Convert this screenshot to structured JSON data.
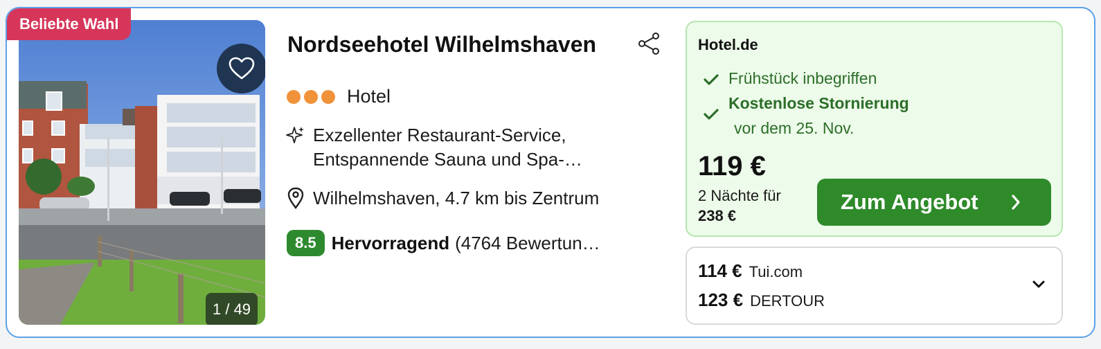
{
  "badge": "Beliebte Wahl",
  "photo": {
    "counter": "1 / 49"
  },
  "hotel": {
    "name": "Nordseehotel Wilhelmshaven",
    "type": "Hotel",
    "stars": 3,
    "features": "Exzellenter Restaurant-Service, Entspannende Sauna und Spa-…",
    "location": "Wilhelmshaven, 4.7 km bis Zentrum",
    "rating": {
      "score": "8.5",
      "label": "Hervorragend",
      "count": "(4764 Bewertun…"
    }
  },
  "offer": {
    "provider": "Hotel.de",
    "perk1": "Frühstück inbegriffen",
    "perk2": "Kostenlose Stornierung",
    "perk2_detail": "vor dem 25. Nov.",
    "price": "119 €",
    "nights": "2 Nächte für",
    "total": "238 €",
    "cta": "Zum Angebot"
  },
  "other_offers": [
    {
      "price": "114 €",
      "provider": "Tui.com"
    },
    {
      "price": "123 €",
      "provider": "DERTOUR"
    }
  ],
  "colors": {
    "border": "#5aa0e6",
    "badge": "#d6365a",
    "star_dot": "#f0923a",
    "score_bg": "#2e8a2e",
    "offer_bg": "#edfbea",
    "cta_bg": "#2f8a2a",
    "perk_text": "#2c6e29"
  },
  "icons": {
    "favorite": "heart-icon",
    "share": "share-icon",
    "feature": "sparkle-icon",
    "location": "location-pin-icon",
    "perk": "checkmark-icon",
    "cta": "chevron-right-icon",
    "expand": "chevron-down-icon"
  }
}
